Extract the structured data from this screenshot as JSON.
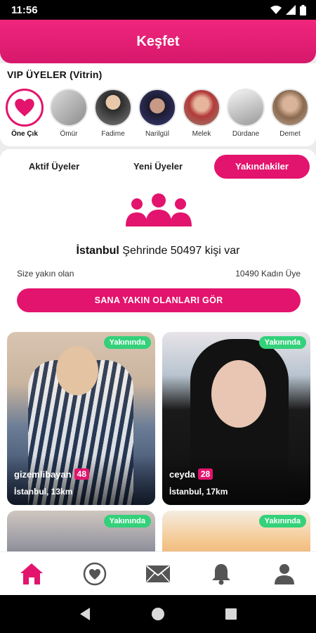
{
  "status_bar": {
    "time": "11:56"
  },
  "app_bar": {
    "title": "Keşfet"
  },
  "vip": {
    "title": "VIP ÜYELER (Vitrin)",
    "feature_label": "Öne Çık",
    "members": [
      "Ömür",
      "Fadime",
      "Narilgül",
      "Melek",
      "Dürdane",
      "Demet"
    ]
  },
  "tabs": {
    "active": "Yakındakiler",
    "items": [
      "Aktif Üyeler",
      "Yeni Üyeler",
      "Yakındakiler"
    ]
  },
  "summary": {
    "city": "İstanbul",
    "city_text": " Şehrinde 50497 kişi var",
    "near_label": "Size yakın olan",
    "women_count": "10490 Kadın Üye",
    "cta": "SANA YAKIN OLANLARI GÖR"
  },
  "cards": [
    {
      "badge": "Yakınında",
      "username": "gizemlibayan",
      "age": "48",
      "location": "İstanbul, 13km"
    },
    {
      "badge": "Yakınında",
      "username": "ceyda",
      "age": "28",
      "location": "İstanbul, 17km"
    },
    {
      "badge": "Yakınında",
      "username": "",
      "age": "",
      "location": ""
    },
    {
      "badge": "Yakınında",
      "username": "",
      "age": "",
      "location": ""
    }
  ],
  "bottom_nav": [
    "home-icon",
    "heart-icon",
    "mail-icon",
    "bell-icon",
    "profile-icon"
  ],
  "colors": {
    "brand": "#e3146d",
    "badge": "#33d17a"
  }
}
